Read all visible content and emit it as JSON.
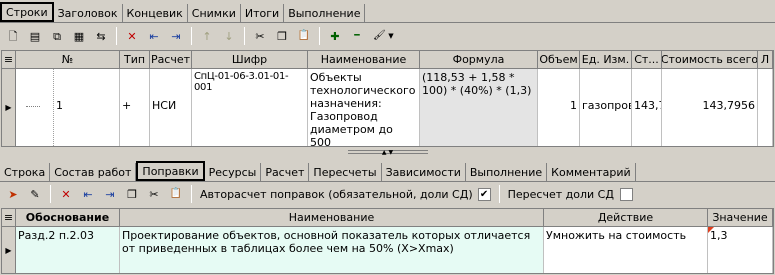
{
  "top_tabs": [
    "Строки",
    "Заголовок",
    "Концевик",
    "Снимки",
    "Итоги",
    "Выполнение"
  ],
  "top_toolbar": [
    {
      "name": "new-doc-icon",
      "glyph": "🗋"
    },
    {
      "name": "open-list-icon",
      "glyph": "▤"
    },
    {
      "name": "copy-doc-icon",
      "glyph": "⧉"
    },
    {
      "name": "doc-props-icon",
      "glyph": "▦"
    },
    {
      "name": "transfer-icon",
      "glyph": "⇆"
    },
    {
      "name": "delete-icon",
      "glyph": "✕"
    },
    {
      "name": "import-icon",
      "glyph": "⇤"
    },
    {
      "name": "export-icon",
      "glyph": "⇥"
    },
    {
      "name": "move-up-icon",
      "glyph": "↑"
    },
    {
      "name": "move-down-icon",
      "glyph": "↓"
    },
    {
      "name": "cut-icon",
      "glyph": "✂"
    },
    {
      "name": "copy-icon",
      "glyph": "❐"
    },
    {
      "name": "paste-icon",
      "glyph": "📋"
    },
    {
      "name": "expand-icon",
      "glyph": "✚"
    },
    {
      "name": "collapse-icon",
      "glyph": "━"
    },
    {
      "name": "paint-icon",
      "glyph": "🖌"
    }
  ],
  "main_grid": {
    "headers": [
      "№",
      "Тип",
      "Расчет",
      "Шифр",
      "Наименование",
      "Формула",
      "Объем",
      "Ед. Изм.",
      "Ст...",
      "Стоимость всего",
      "Л"
    ],
    "row": {
      "num": "1",
      "type": "+",
      "calc": "НСИ",
      "code": "СпЦ-01-06-3.01-01-001",
      "name": "Объекты технологического назначения: Газопровод диаметром до 500",
      "formula": "(118,53 + 1,58 * 100) * (40%) * (1,3)",
      "volume": "1",
      "unit": "газопров",
      "price": "143,7",
      "total": "143,7956"
    }
  },
  "bottom_tabs": [
    "Строка",
    "Состав работ",
    "Поправки",
    "Ресурсы",
    "Расчет",
    "Пересчеты",
    "Зависимости",
    "Выполнение",
    "Комментарий"
  ],
  "bottom_toolbar": [
    {
      "name": "add-correction-icon",
      "glyph": "➤"
    },
    {
      "name": "edit-correction-icon",
      "glyph": "✎"
    },
    {
      "name": "delete-correction-icon",
      "glyph": "✕"
    },
    {
      "name": "import-correction-icon",
      "glyph": "⇤"
    },
    {
      "name": "export-correction-icon",
      "glyph": "⇥"
    },
    {
      "name": "copy-correction-icon",
      "glyph": "❐"
    },
    {
      "name": "cut-correction-icon",
      "glyph": "✂"
    },
    {
      "name": "paste-correction-icon",
      "glyph": "📋"
    }
  ],
  "auto_calc_label": "Авторасчет поправок (обязательной, доли СД)",
  "auto_calc_checked": "✔",
  "recalc_label": "Пересчет доли СД",
  "corrections": {
    "headers": [
      "Обоснование",
      "Наименование",
      "Действие",
      "Значение"
    ],
    "row": {
      "basis": "Разд.2 п.2.03",
      "name": "Проектирование объектов, основной показатель которых отличается от приведенных в таблицах более чем на 50% (X>Xmax)",
      "action": "Умножить на стоимость",
      "value": "1,3"
    }
  }
}
